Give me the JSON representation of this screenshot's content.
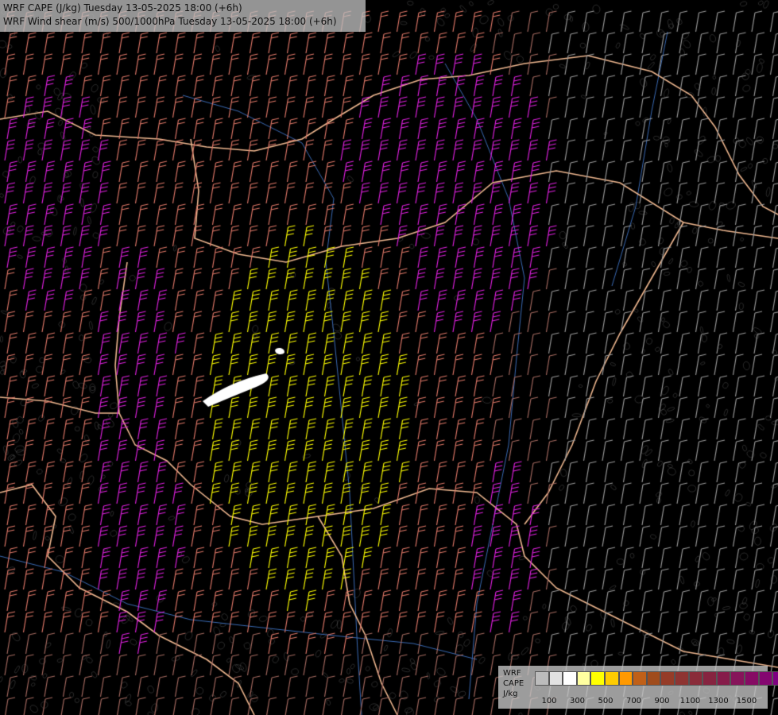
{
  "title": {
    "line1": "WRF CAPE (J/kg) Tuesday 13-05-2025 18:00 (+6h)",
    "line2": "WRF Wind shear (m/s) 500/1000hPa Tuesday 13-05-2025 18:00 (+6h)"
  },
  "legend": {
    "model": "WRF",
    "field": "CAPE",
    "unit": "J/kg",
    "colors": [
      "#bcbcbc",
      "#e2e2e2",
      "#ffffff",
      "#ffffa0",
      "#ffff00",
      "#ffcc00",
      "#ff9900",
      "#c06018",
      "#a04c1c",
      "#953c28",
      "#8e3432",
      "#8a2c3a",
      "#862440",
      "#861c4a",
      "#86145a",
      "#860c64",
      "#840670",
      "#7e0080"
    ],
    "tick_labels": [
      "100",
      "300",
      "500",
      "700",
      "900",
      "1100",
      "1300",
      "1500"
    ]
  },
  "map": {
    "field_colors": {
      "yellow": "#ffff00",
      "magenta": "#e020e0",
      "salmon": "#e07868",
      "brown": "#a56a60",
      "gray": "#9a9a9a"
    },
    "border_color": "#f0b890",
    "river_color": "#3a6ab4"
  }
}
